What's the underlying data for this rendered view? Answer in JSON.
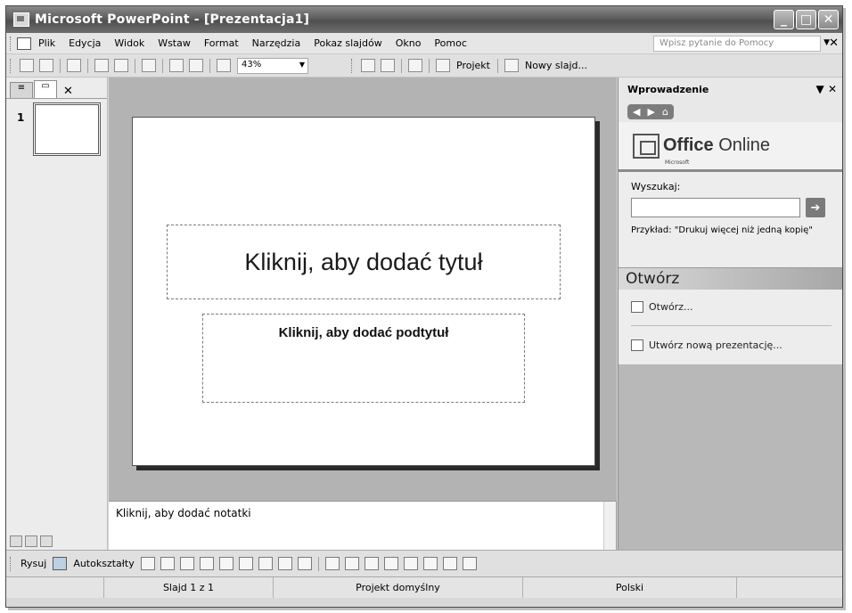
{
  "window": {
    "title": "Microsoft PowerPoint - [Prezentacja1]",
    "buttons": {
      "minimize": "_",
      "maximize": "□",
      "close": "✕"
    }
  },
  "menu": {
    "items": [
      "Plik",
      "Edycja",
      "Widok",
      "Wstaw",
      "Format",
      "Narzędzia",
      "Pokaz slajdów",
      "Okno",
      "Pomoc"
    ],
    "help_placeholder": "Wpisz pytanie do Pomocy",
    "close_glyph": "✕"
  },
  "toolbar": {
    "zoom": "43%",
    "design_label": "Projekt",
    "new_slide_label": "Nowy slajd..."
  },
  "left_pane": {
    "close_glyph": "✕",
    "slide_number": "1"
  },
  "slide": {
    "title_placeholder": "Kliknij, aby dodać tytuł",
    "subtitle_placeholder": "Kliknij, aby dodać podtytuł"
  },
  "notes": {
    "placeholder": "Kliknij, aby dodać notatki"
  },
  "task_pane": {
    "title": "Wprowadzenie",
    "logo_small": "Microsoft",
    "logo_office": "Office",
    "logo_online": " Online",
    "search_label": "Wyszukaj:",
    "go_glyph": "➔",
    "example_text": "Przykład:  \"Drukuj więcej niż jedną kopię\"",
    "open_section": "Otwórz",
    "open_link": "Otwórz...",
    "new_presentation_link": "Utwórz nową prezentację..."
  },
  "draw_toolbar": {
    "draw_label": "Rysuj",
    "autoshapes_label": "Autokształty"
  },
  "status": {
    "slide": "Slajd 1 z 1",
    "design": "Projekt domyślny",
    "language": "Polski"
  }
}
